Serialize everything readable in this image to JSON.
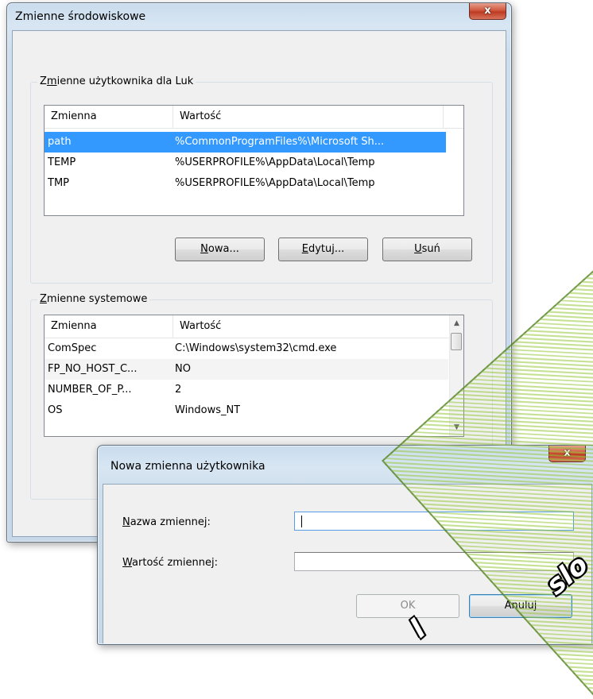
{
  "env_dialog": {
    "title": "Zmienne środowiskowe",
    "close_label": "x",
    "user_group": {
      "title_pre": "Z",
      "title_accel": "m",
      "title_post": "ienne użytkownika dla Luk",
      "headers": [
        "Zmienna",
        "Wartość"
      ],
      "rows": [
        {
          "name": "path",
          "value": "%CommonProgramFiles%\\Microsoft Sh..."
        },
        {
          "name": "TEMP",
          "value": "%USERPROFILE%\\AppData\\Local\\Temp"
        },
        {
          "name": "TMP",
          "value": "%USERPROFILE%\\AppData\\Local\\Temp"
        }
      ],
      "buttons": {
        "new": {
          "accel": "N",
          "rest": "owa..."
        },
        "edit": {
          "accel": "E",
          "rest": "dytuj..."
        },
        "delete": {
          "accel": "U",
          "rest": "suń"
        }
      }
    },
    "system_group": {
      "title_accel": "Z",
      "title_post": "mienne systemowe",
      "headers": [
        "Zmienna",
        "Wartość"
      ],
      "rows": [
        {
          "name": "ComSpec",
          "value": "C:\\Windows\\system32\\cmd.exe"
        },
        {
          "name": "FP_NO_HOST_C...",
          "value": "NO"
        },
        {
          "name": "NUMBER_OF_P...",
          "value": "2"
        },
        {
          "name": "OS",
          "value": "Windows_NT"
        }
      ]
    }
  },
  "new_var_dialog": {
    "title": "Nowa zmienna użytkownika",
    "close_label": "x",
    "name_label": {
      "accel": "N",
      "rest": "azwa zmiennej:"
    },
    "value_label": {
      "accel": "W",
      "rest": "artość zmiennej:"
    },
    "name_value": "",
    "value_value": "",
    "ok_label": "OK",
    "cancel_label": "Anuluj"
  },
  "watermark": {
    "text_1": "slo",
    "text_2": "l"
  },
  "colors": {
    "selection": "#3399ff",
    "close_button": "#c94a33",
    "frame": "#c9dced"
  }
}
